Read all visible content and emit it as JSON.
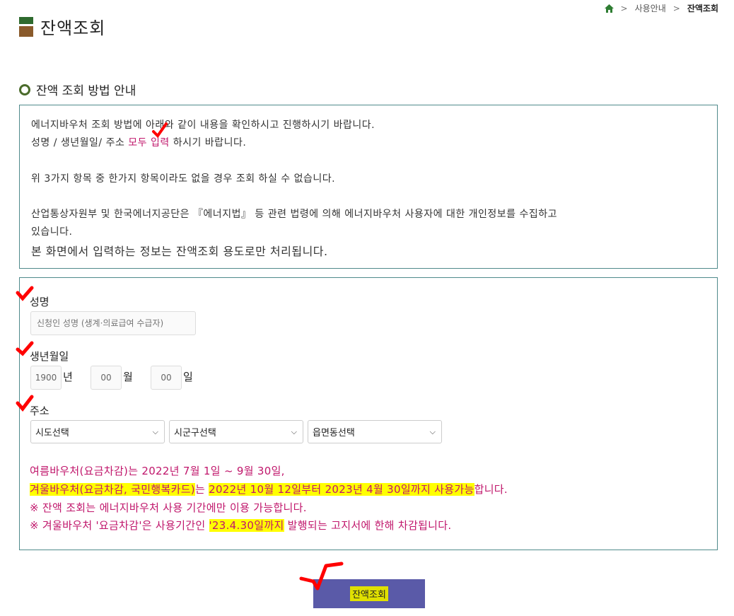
{
  "breadcrumb": {
    "home": "home",
    "parent": "사용안내",
    "current": "잔액조회"
  },
  "page": {
    "title": "잔액조회"
  },
  "guide": {
    "title": "잔액 조회 방법 안내",
    "line1": "에너지바우처 조회 방법에 아래와 같이 내용을 확인하시고 진행하시기 바랍니다.",
    "line2_pre": "성명 / 생년월일/ 주소 ",
    "line2_emph": "모두 입력",
    "line2_post": " 하시기 바랍니다.",
    "line3": "위 3가지 항목 중 한가지 항목이라도 없을 경우 조회 하실 수 없습니다.",
    "line4a": "산업통상자원부 및 한국에너지공단은 『에너지법』 등 관련 법령에 의해 에너지바우처 사용자에 대한 개인정보를 수집하고",
    "line4b": "있습니다.",
    "line5": "본 화면에서 입력하는 정보는 잔액조회 용도로만 처리됩니다."
  },
  "form": {
    "name_label": "성명",
    "name_placeholder": "신청인 성명 (생계·의료급여 수급자)",
    "birth_label": "생년월일",
    "year_value": "1900",
    "year_unit": "년",
    "month_value": "00",
    "month_unit": "월",
    "day_value": "00",
    "day_unit": "일",
    "address_label": "주소",
    "sido": "시도선택",
    "sigungu": "시군구선택",
    "emd": "읍면동선택"
  },
  "notices": {
    "n1": "여름바우처(요금차감)는 2022년 7월 1일 ~ 9월 30일,",
    "n2_hl1": "겨울바우처(요금차감, 국민행복카드)",
    "n2_mid": "는 ",
    "n2_hl2": "2022년 10월 12일부터 2023년 4월 30일까지 사용가능",
    "n2_end": "합니다.",
    "n3": "※ 잔액 조회는 에너지바우처 사용 기간에만 이용 가능합니다.",
    "n4_pre": "※ 겨울바우처 '요금차감'은 사용기간인 ",
    "n4_hl": "'23.4.30일까지",
    "n4_post": " 발행되는 고지서에 한해 차감됩니다."
  },
  "submit": {
    "label": "잔액조회"
  },
  "colors": {
    "accent": "#c0166b",
    "button": "#5a5aa8",
    "border": "#4f8a8b",
    "highlight": "#ffff00",
    "annotation": "#ff0000"
  }
}
